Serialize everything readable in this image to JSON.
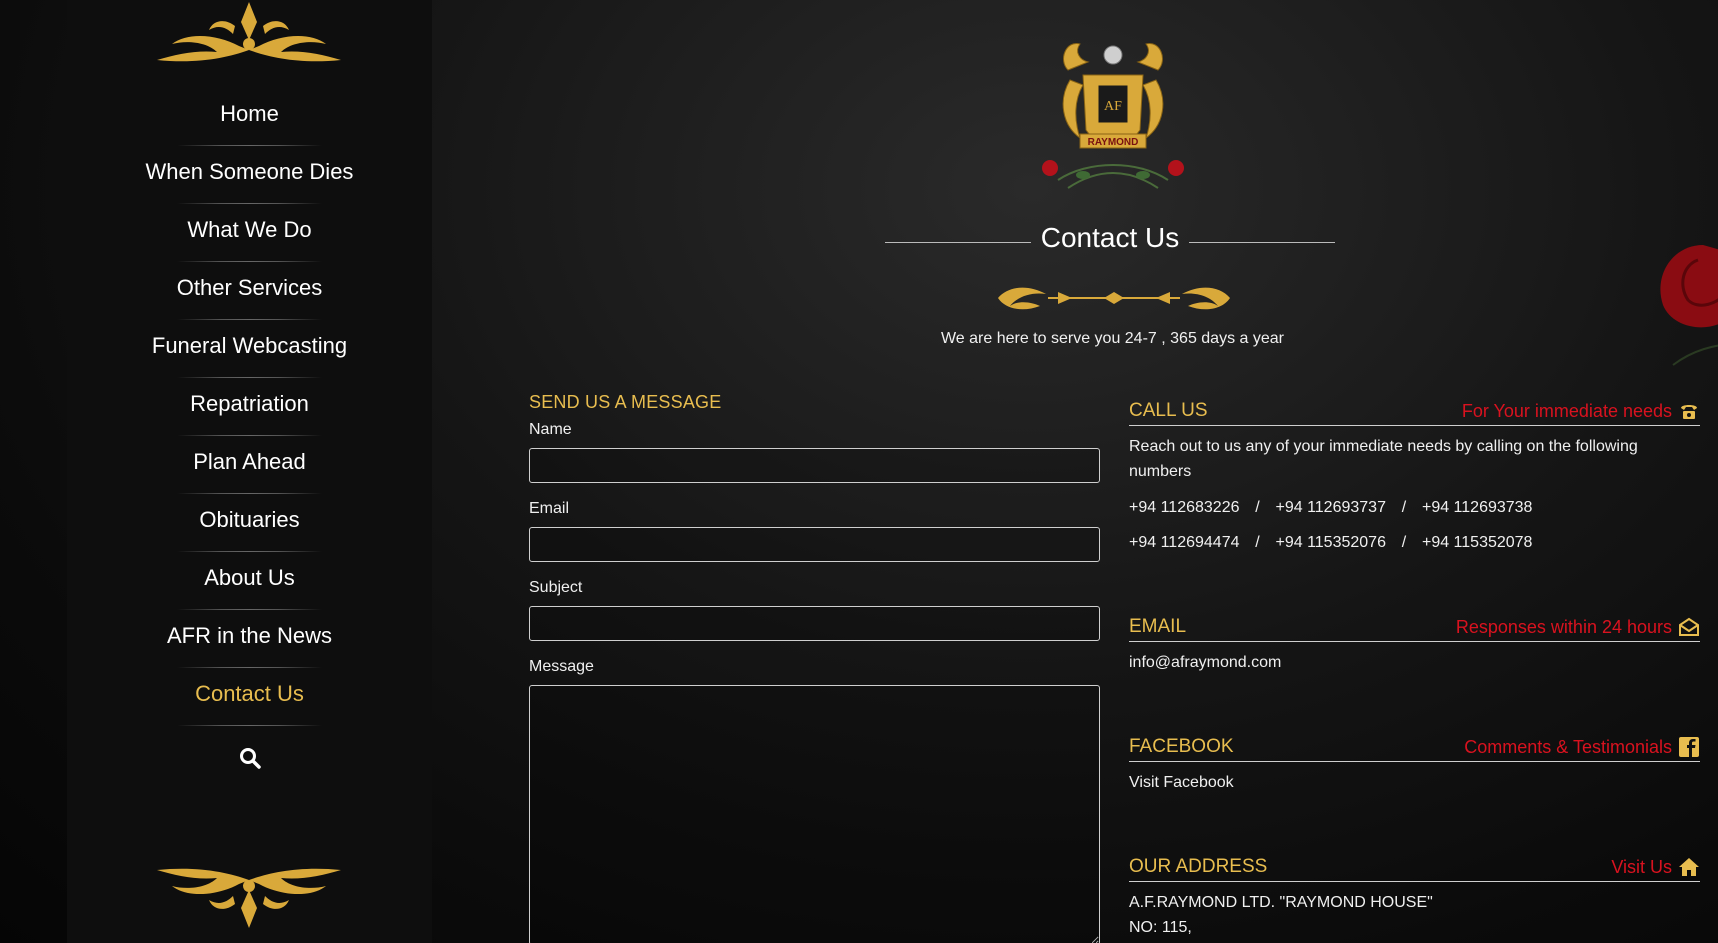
{
  "nav": {
    "items": [
      {
        "label": "Home"
      },
      {
        "label": "When Someone Dies"
      },
      {
        "label": "What We Do"
      },
      {
        "label": "Other Services"
      },
      {
        "label": "Funeral Webcasting"
      },
      {
        "label": "Repatriation"
      },
      {
        "label": "Plan Ahead"
      },
      {
        "label": "Obituaries"
      },
      {
        "label": "About Us"
      },
      {
        "label": "AFR in the News"
      },
      {
        "label": "Contact Us"
      }
    ],
    "active_index": 10,
    "search_icon": "search-icon"
  },
  "logo": {
    "label": "RAYMOND"
  },
  "page": {
    "title": "Contact Us",
    "tagline": "We are here to serve you 24-7 , 365 days a year"
  },
  "form": {
    "heading": "SEND US A MESSAGE",
    "name_label": "Name",
    "email_label": "Email",
    "subject_label": "Subject",
    "message_label": "Message"
  },
  "call": {
    "title": "CALL US",
    "note": "For Your immediate needs",
    "icon": "phone-icon",
    "text": "Reach out to us any of your immediate needs by calling on the following numbers",
    "phones_row1": [
      "+94 112683226",
      "+94 112693737",
      "+94 112693738"
    ],
    "phones_row2": [
      "+94 112694474",
      "+94 115352076",
      "+94 115352078"
    ],
    "separator": "/"
  },
  "email": {
    "title": "EMAIL",
    "note": "Responses within 24 hours",
    "icon": "envelope-icon",
    "address": "info@afraymond.com"
  },
  "facebook": {
    "title": "FACEBOOK",
    "note": "Comments & Testimonials",
    "icon": "facebook-icon",
    "link": "Visit Facebook"
  },
  "address": {
    "title": "OUR ADDRESS",
    "note": "Visit Us",
    "icon": "home-icon",
    "line1": "A.F.RAYMOND LTD. \"RAYMOND HOUSE\"",
    "line2": "NO: 115,"
  },
  "colors": {
    "gold": "#e8bd4f",
    "red": "#d9121f",
    "sidebar": "#0e0e0e"
  }
}
